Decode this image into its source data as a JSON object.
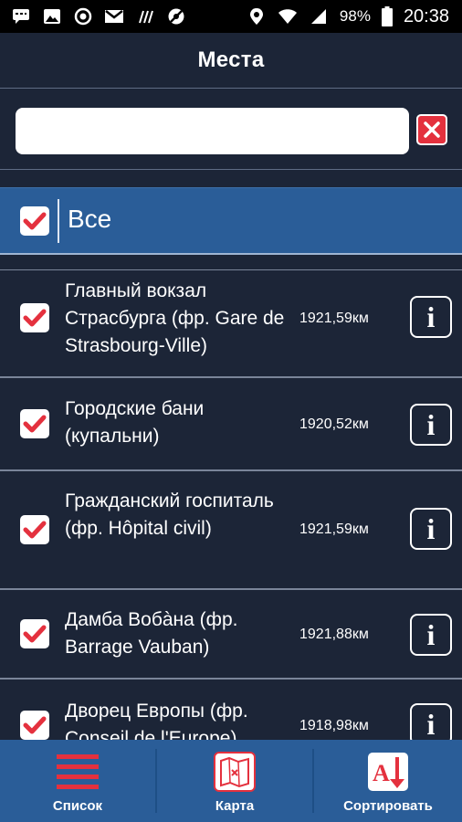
{
  "status_bar": {
    "battery_percent": "98%",
    "time": "20:38",
    "icons": [
      "sms-icon",
      "image-icon",
      "sync-icon",
      "gmail-icon",
      "signal-off-icon",
      "blocked-icon",
      "location-icon",
      "wifi-icon",
      "cell-signal-icon",
      "battery-icon"
    ]
  },
  "header": {
    "title": "Места"
  },
  "search": {
    "value": "",
    "placeholder": ""
  },
  "all_row": {
    "label": "Все",
    "checked": true
  },
  "places": [
    {
      "name": "Главный вокзал Страсбурга (фр. Gare de Strasbourg-Ville)",
      "distance": "1921,59км",
      "checked": true
    },
    {
      "name": "Городские бани (купальни)",
      "distance": "1920,52км",
      "checked": true
    },
    {
      "name": "Гражданский госпиталь (фр. Hôpital civil)",
      "distance": "1921,59км",
      "checked": true
    },
    {
      "name": "Дамба Вобàна (фр. Barrage Vauban)",
      "distance": "1921,88км",
      "checked": true
    },
    {
      "name": "Дворец Европы (фр. Conseil de l'Europe)",
      "distance": "1918,98км",
      "checked": true
    }
  ],
  "bottom_tabs": [
    {
      "label": "Список",
      "icon": "list-icon"
    },
    {
      "label": "Карта",
      "icon": "map-icon"
    },
    {
      "label": "Сортировать",
      "icon": "sort-icon"
    }
  ],
  "colors": {
    "background": "#1c2537",
    "accent_blue": "#2a5d98",
    "check_red": "#e4313e"
  }
}
